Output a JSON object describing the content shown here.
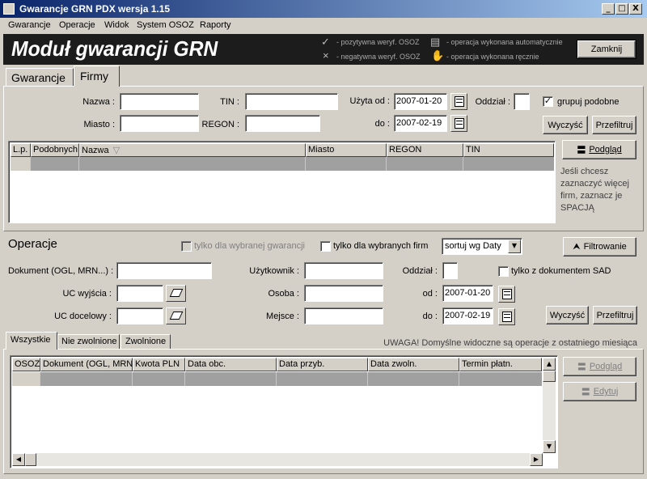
{
  "window": {
    "title": "Gwarancje GRN PDX wersja 1.15",
    "controls": [
      "_",
      "□",
      "X"
    ]
  },
  "menu": [
    "Gwarancje",
    "Operacje",
    "Widok",
    "System OSOZ",
    "Raporty"
  ],
  "banner": {
    "title": "Moduł gwarancji GRN",
    "legend": {
      "positive": "- pozytywna weryf. OSOZ",
      "negative": "- negatywna weryf. OSOZ",
      "auto": "- operacja wykonana automatycznie",
      "manual": "- operacja wykonana ręcznie"
    },
    "close_label": "Zamknij"
  },
  "main_tabs": [
    "Gwarancje",
    "Firmy"
  ],
  "firms": {
    "nazwa_label": "Nazwa :",
    "nazwa_value": "",
    "miasto_label": "Miasto :",
    "miasto_value": "",
    "tin_label": "TIN :",
    "tin_value": "",
    "regon_label": "REGON :",
    "regon_value": "",
    "used_from_label": "Użyta od :",
    "used_from_value": "2007-01-20",
    "to_label": "do :",
    "to_value": "2007-02-19",
    "branch_label": "Oddział :",
    "branch_value": "",
    "group_similar_label": "grupuj podobne",
    "group_similar_checked": "✓",
    "clear_label": "Wyczyść",
    "refilter_label": "Przefiltruj",
    "columns": [
      "L.p.",
      "Podobnych",
      "Nazwa",
      "Miasto",
      "REGON",
      "TIN"
    ],
    "sort_indicator": "▽",
    "preview_label": "Podgląd",
    "hint": "Jeśli chcesz zaznaczyć więcej firm, zaznacz je SPACJĄ"
  },
  "operations": {
    "title": "Operacje",
    "only_selected_guarantee": "tylko dla wybranej gwarancji",
    "only_selected_firms": "tylko dla wybranych firm",
    "sort_value": "sortuj wg Daty",
    "filtering_label": "Filtrowanie",
    "document_label": "Dokument (OGL, MRN...) :",
    "document_value": "",
    "user_label": "Użytkownik :",
    "user_value": "",
    "branch_label": "Oddział :",
    "branch_value": "",
    "only_sad_label": "tylko z dokumentem SAD",
    "uc_out_label": "UC wyjścia :",
    "uc_out_value": "",
    "person_label": "Osoba :",
    "person_value": "",
    "from_label": "od :",
    "from_value": "2007-01-20",
    "uc_dest_label": "UC docelowy :",
    "uc_dest_value": "",
    "place_label": "Mejsce :",
    "place_value": "",
    "to_label": "do :",
    "to_value": "2007-02-19",
    "clear_label": "Wyczyść",
    "refilter_label": "Przefiltruj",
    "tabs": [
      "Wszystkie",
      "Nie zwolnione",
      "Zwolnione"
    ],
    "warning": "UWAGA! Domyślne widoczne są operacje z ostatniego miesiąca",
    "columns": [
      "OSOZ",
      "Dokument (OGL, MRN...",
      "Kwota PLN",
      "Data obc.",
      "Data przyb.",
      "Data zwoln.",
      "Termin płatn."
    ],
    "preview_label": "Podgląd",
    "edit_label": "Edytuj"
  }
}
